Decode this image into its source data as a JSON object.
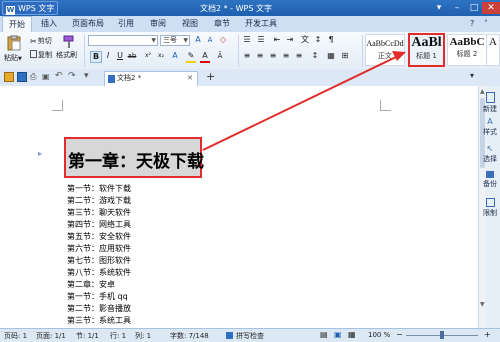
{
  "app": {
    "button_label": "WPS 文字",
    "window_title": "文档2 * - WPS 文字"
  },
  "menu": {
    "items": [
      "开始",
      "插入",
      "页面布局",
      "引用",
      "审阅",
      "视图",
      "章节",
      "开发工具"
    ],
    "active": "开始"
  },
  "ribbon": {
    "paste": "粘贴",
    "cut": "剪切",
    "copy": "复制",
    "format_painter": "格式刷",
    "font_size": "三号",
    "styles": [
      {
        "preview": "AaBbCcDd",
        "label": "正文"
      },
      {
        "preview": "AaBl",
        "label": "标题 1"
      },
      {
        "preview": "AaBbC",
        "label": "标题 2"
      },
      {
        "preview": "A",
        "label": ""
      }
    ]
  },
  "tabs": {
    "doc_tab": "文档2 *",
    "add": "+"
  },
  "right_panel": [
    "新建",
    "样式",
    "选择",
    "备份",
    "限制"
  ],
  "document": {
    "heading": "第一章：天极下载",
    "lines": [
      "第一节：软件下载",
      "第二节：游戏下载",
      "第三节：聊天软件",
      "第四节：网络工具",
      "第五节：安全软件",
      "第六节：应用软件",
      "第七节：图形软件",
      "第八节：系统软件",
      "第二章：安卓",
      "第一节：手机 qq",
      "第二节：影音播放",
      "第三节：系统工具"
    ]
  },
  "status": {
    "page_num": "页码: 1",
    "pages": "页面: 1/1",
    "section": "节: 1/1",
    "row": "行: 1",
    "col": "列: 1",
    "words": "字数: 7/148",
    "spell": "拼写检查",
    "zoom": "100 %"
  },
  "colors": {
    "accent": "#1f5fae",
    "highlight_box": "#e22b2b",
    "heading_bg": "#d7d7d7"
  }
}
